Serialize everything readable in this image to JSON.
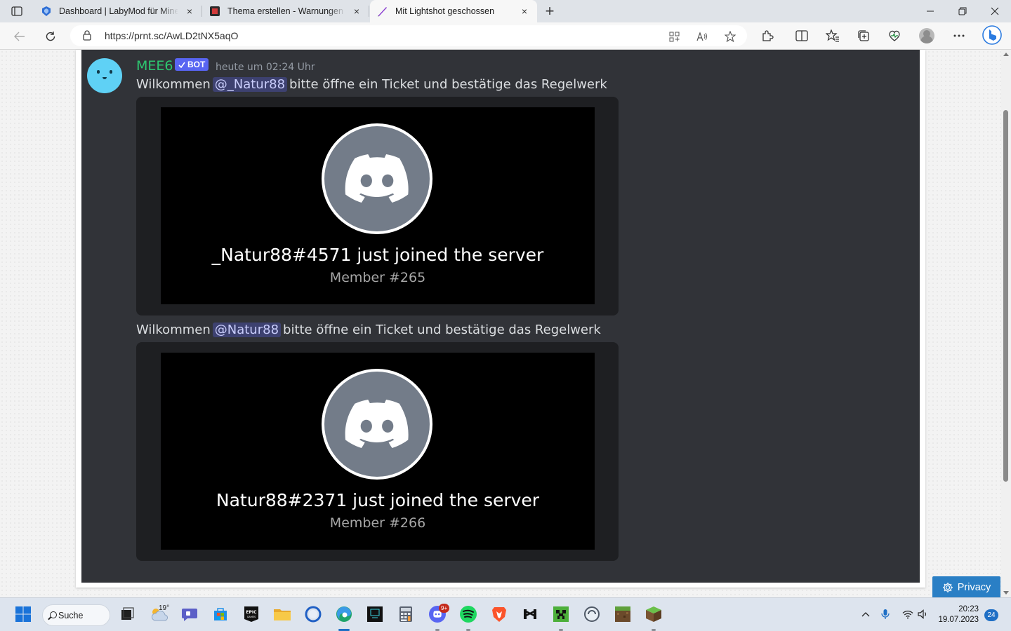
{
  "browser": {
    "tabs": [
      {
        "label": "Dashboard | LabyMod für Minecraft",
        "icon": "labymod-icon",
        "close": "×"
      },
      {
        "label": "Thema erstellen - Warnungen von",
        "icon": "forum-icon",
        "close": "×"
      },
      {
        "label": "Mit Lightshot geschossen",
        "icon": "lightshot-icon",
        "close": "×",
        "active": true
      }
    ],
    "new_tab": "+",
    "window_controls": {
      "minimize": "—",
      "maximize": "▢",
      "close": "✕"
    },
    "url": "https://prnt.sc/AwLD2tNX5aqO",
    "toolbar_icons": [
      "back-icon",
      "reload-icon",
      "lock-icon",
      "app-icon",
      "read-aloud-icon",
      "favorite-star-icon",
      "extensions-icon",
      "split-screen-icon",
      "favorites-icon",
      "collections-icon",
      "browser-essentials-icon",
      "profile-icon",
      "more-icon",
      "bing-icon"
    ]
  },
  "discord": {
    "author": "MEE6",
    "bot_badge": "BOT",
    "timestamp": "heute um 02:24 Uhr",
    "messages": [
      {
        "prefix": "Wilkommen",
        "mention": "@_Natur88",
        "suffix": "bitte öffne ein Ticket und bestätige das Regelwerk",
        "joined_text": "_Natur88#4571 just joined the server",
        "member_text": "Member #265"
      },
      {
        "prefix": "Wilkommen",
        "mention": "@Natur88",
        "suffix": "bitte öffne ein Ticket und bestätige das Regelwerk",
        "joined_text": "Natur88#2371 just joined the server",
        "member_text": "Member #266"
      }
    ]
  },
  "privacy_button": "Privacy",
  "taskbar": {
    "search_label": "Suche",
    "weather_temp": "19°",
    "discord_badge": "9+",
    "clock_time": "20:23",
    "clock_date": "19.07.2023",
    "notification_count": "24"
  },
  "colors": {
    "discord_bg": "#313338",
    "embed_bg": "#1e1f22",
    "mention_bg": "#3c4270",
    "author_green": "#2dc770",
    "blurple": "#5865f2",
    "privacy_blue": "#2a7fc5"
  }
}
